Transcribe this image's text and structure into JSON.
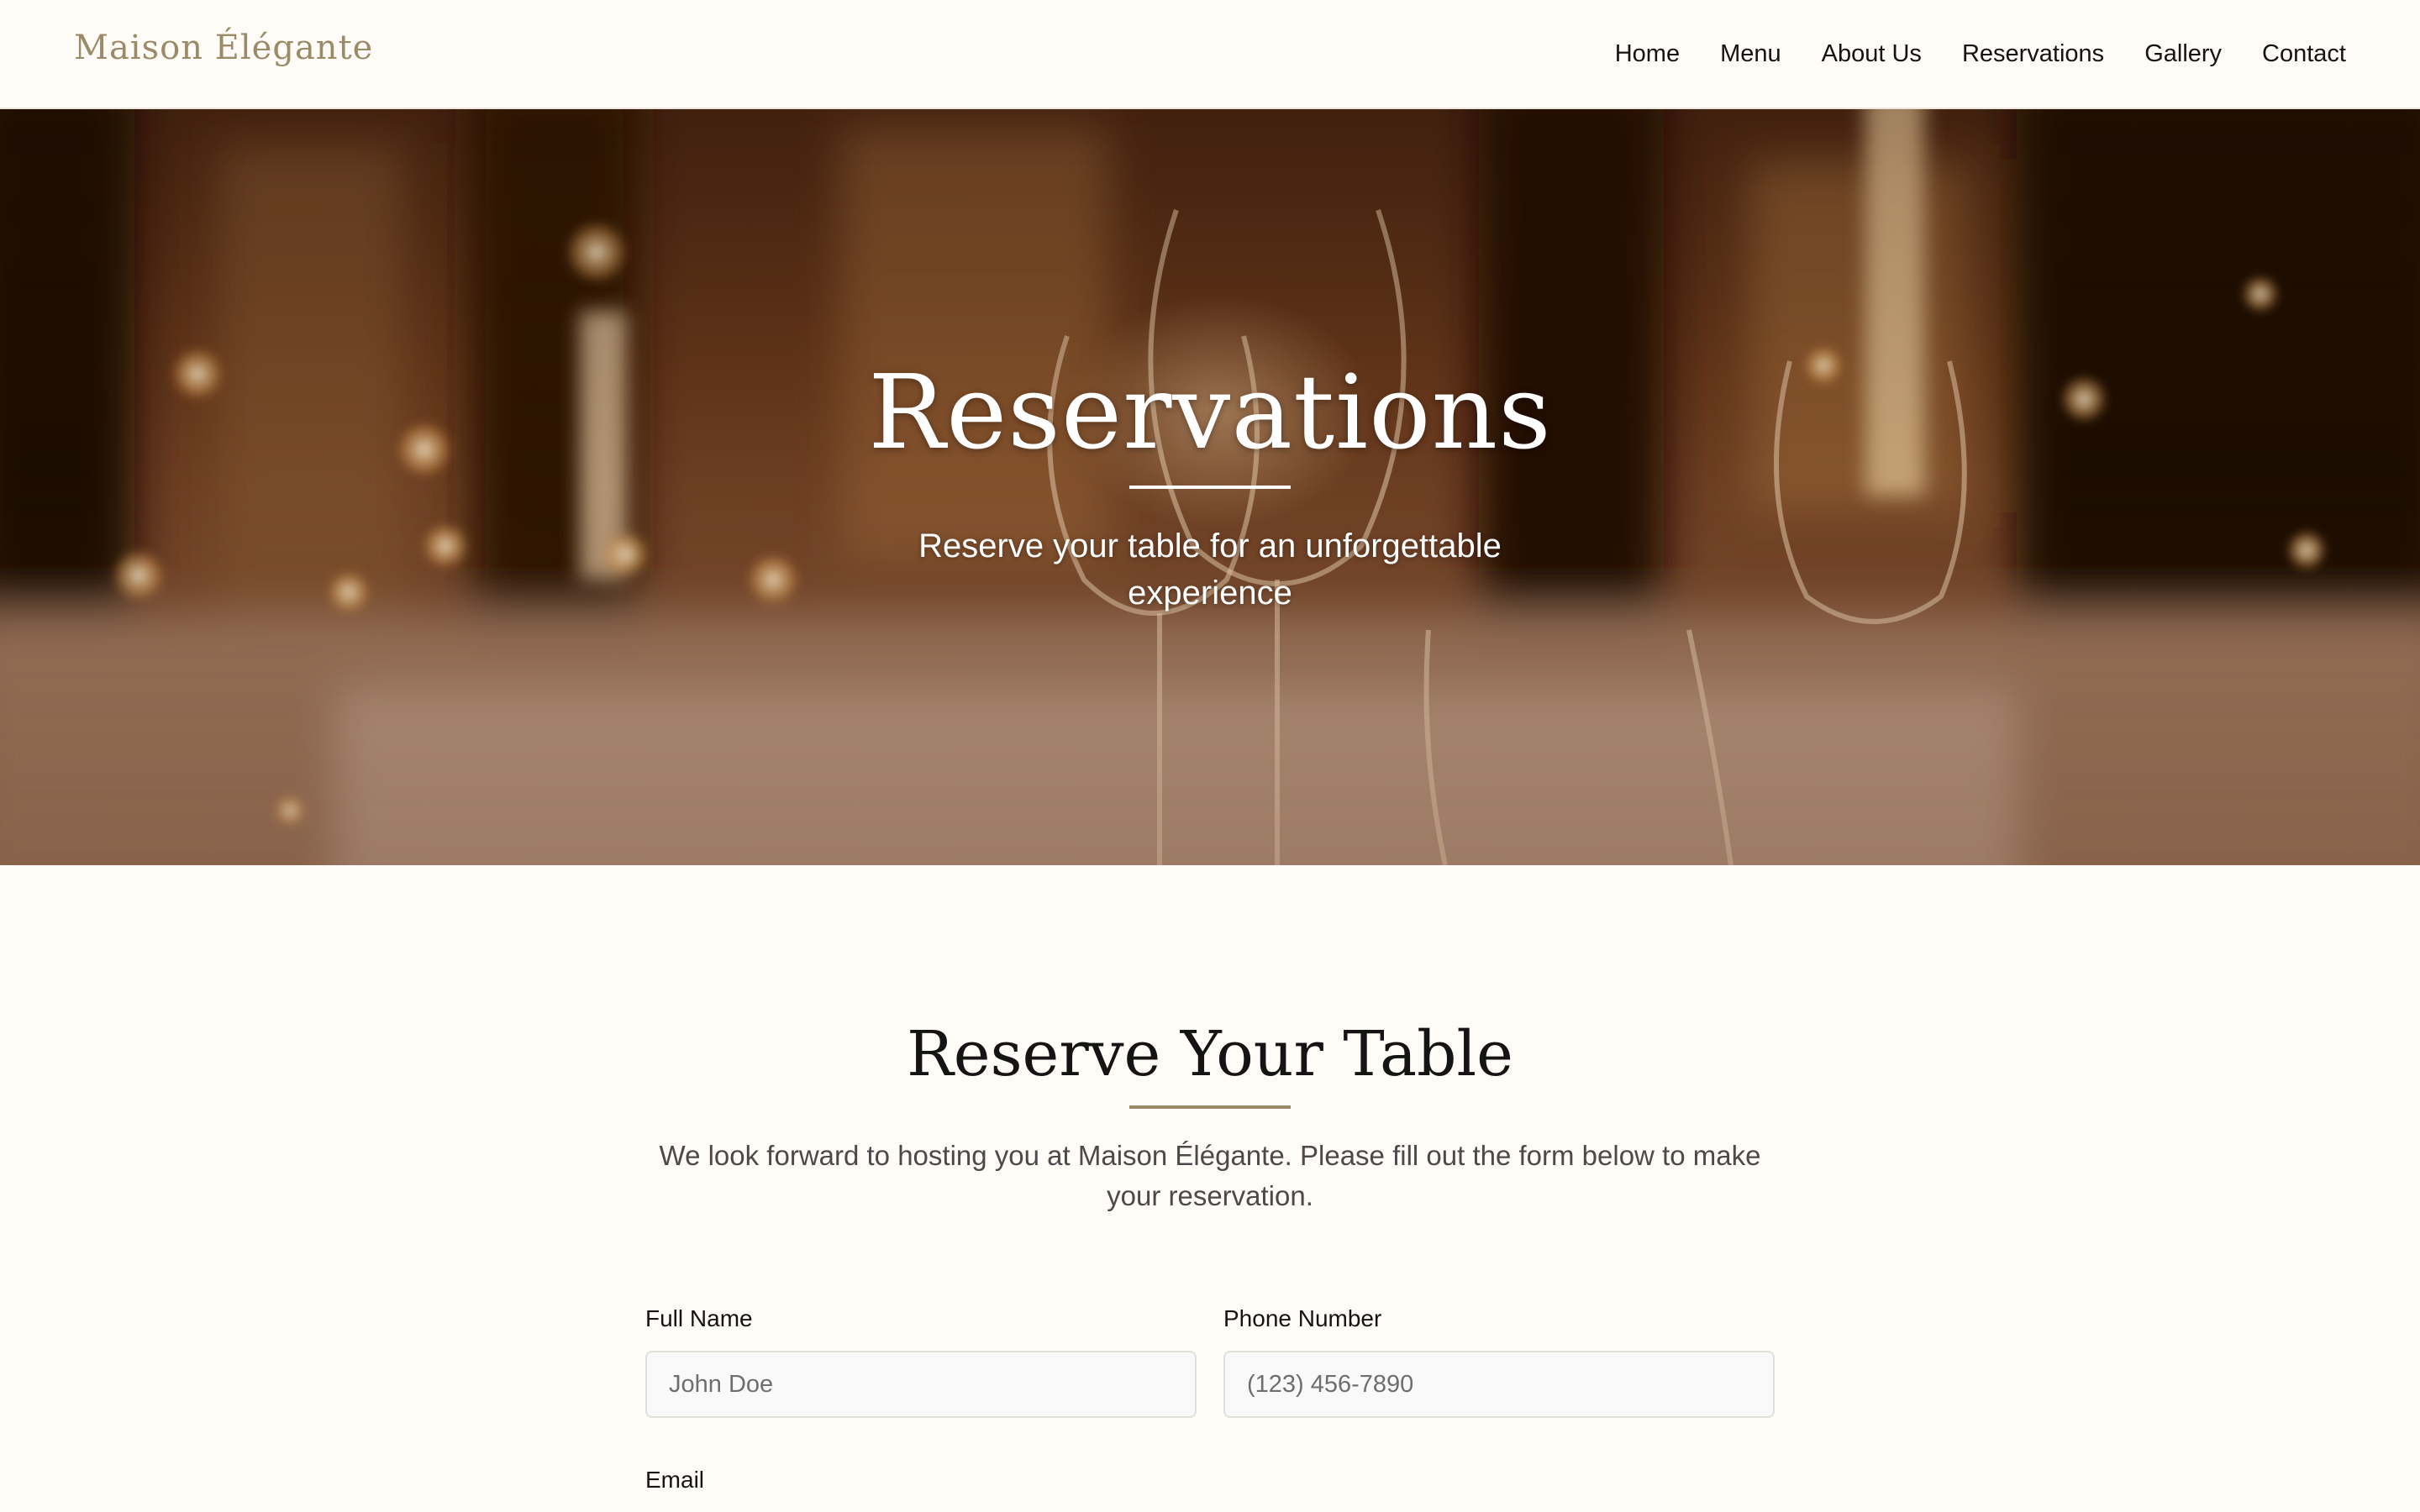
{
  "header": {
    "logo": "Maison Élégante",
    "nav": [
      {
        "label": "Home"
      },
      {
        "label": "Menu"
      },
      {
        "label": "About Us"
      },
      {
        "label": "Reservations"
      },
      {
        "label": "Gallery"
      },
      {
        "label": "Contact"
      }
    ]
  },
  "hero": {
    "title": "Reservations",
    "subtitle": "Reserve your table for an unforgettable experience",
    "background": "blurred-candlelit-dining-table-with-wine-glasses"
  },
  "reserve": {
    "title": "Reserve Your Table",
    "intro": "We look forward to hosting you at Maison Élégante. Please fill out the form below to make your reservation.",
    "fields": {
      "name": {
        "label": "Full Name",
        "placeholder": "John Doe"
      },
      "phone": {
        "label": "Phone Number",
        "placeholder": "(123) 456-7890"
      },
      "email": {
        "label": "Email"
      }
    }
  },
  "colors": {
    "accent": "#9b8a68",
    "background": "#fffcf7",
    "text": "#141414",
    "input_bg": "#f9f9f9",
    "input_border": "#e3e0da"
  }
}
